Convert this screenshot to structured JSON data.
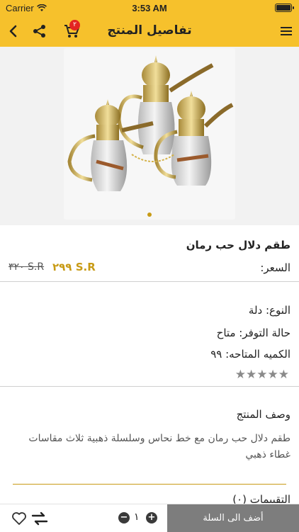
{
  "status_bar": {
    "carrier": "Carrier",
    "time": "3:53 AM"
  },
  "nav": {
    "title": "تفاصيل المنتج",
    "cart_count": "٢"
  },
  "product": {
    "name": "طقم دلال حب رمان",
    "price_label": "السعر:",
    "new_price": "S.R ٢٩٩",
    "old_price": "S.R ٣٢٠",
    "type": "النوع: دلة",
    "availability": "حالة التوفر: متاح",
    "quantity_available": "الكميه المتاحه: ٩٩",
    "rating_stars": "★★★★★",
    "rating": 0
  },
  "description": {
    "title": "وصف المنتج",
    "body": "طقم دلال حب رمان مع خط نحاس وسلسلة ذهبية ثلاث مقاسات غطاء ذهبي",
    "next_section_peek": "التقييمات (٠)"
  },
  "bottom": {
    "add_to_cart": "أضف الى السلة",
    "quantity": "١"
  },
  "colors": {
    "accent": "#f6c12c",
    "gold": "#c89b16",
    "badge": "#e32521",
    "button": "#7d7d7d"
  },
  "icons": [
    "wifi-icon",
    "battery-icon",
    "back-icon",
    "share-icon",
    "cart-icon",
    "menu-icon",
    "heart-icon",
    "swap-icon",
    "plus-icon",
    "minus-icon"
  ]
}
